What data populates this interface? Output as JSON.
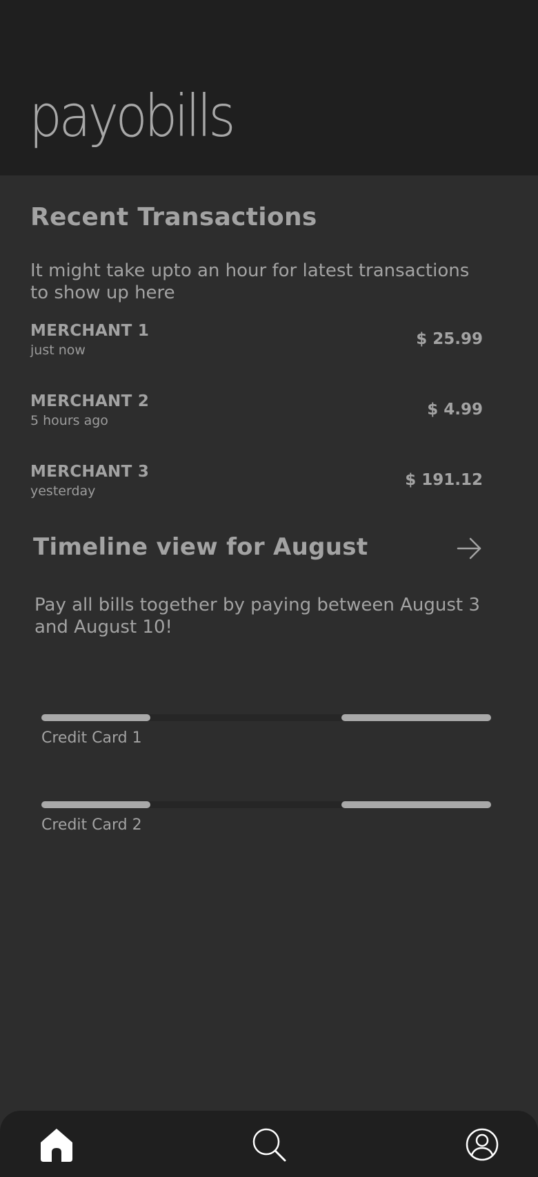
{
  "app": {
    "logo_text": "payobills"
  },
  "recent": {
    "title": "Recent Transactions",
    "note": "It might take upto an hour for latest transactions to show up here",
    "transactions": [
      {
        "merchant": "MERCHANT 1",
        "time": "just now",
        "amount": "$ 25.99"
      },
      {
        "merchant": "MERCHANT 2",
        "time": "5 hours ago",
        "amount": "$ 4.99"
      },
      {
        "merchant": "MERCHANT 3",
        "time": "yesterday",
        "amount": "$ 191.12"
      }
    ]
  },
  "timeline": {
    "title": "Timeline view for August",
    "arrow_icon": "arrow-right-icon",
    "description": "Pay all bills together by paying between August 3 and August 10!",
    "cards": [
      {
        "label": "Credit Card 1",
        "segments": [
          {
            "start": 0.0,
            "end": 0.243
          },
          {
            "start": 0.667,
            "end": 1.0
          }
        ]
      },
      {
        "label": "Credit Card 2",
        "segments": [
          {
            "start": 0.0,
            "end": 0.243
          },
          {
            "start": 0.667,
            "end": 1.0
          }
        ]
      }
    ]
  },
  "nav": {
    "items": [
      {
        "name": "home",
        "icon": "home-icon",
        "active": true
      },
      {
        "name": "search",
        "icon": "search-icon",
        "active": false
      },
      {
        "name": "profile",
        "icon": "profile-icon",
        "active": false
      }
    ]
  },
  "colors": {
    "header_bg": "#1f1f1f",
    "page_bg": "#2d2d2d",
    "text": "#a3a3a3",
    "bar_fill": "#a9a9a9",
    "bar_track": "#262626"
  }
}
